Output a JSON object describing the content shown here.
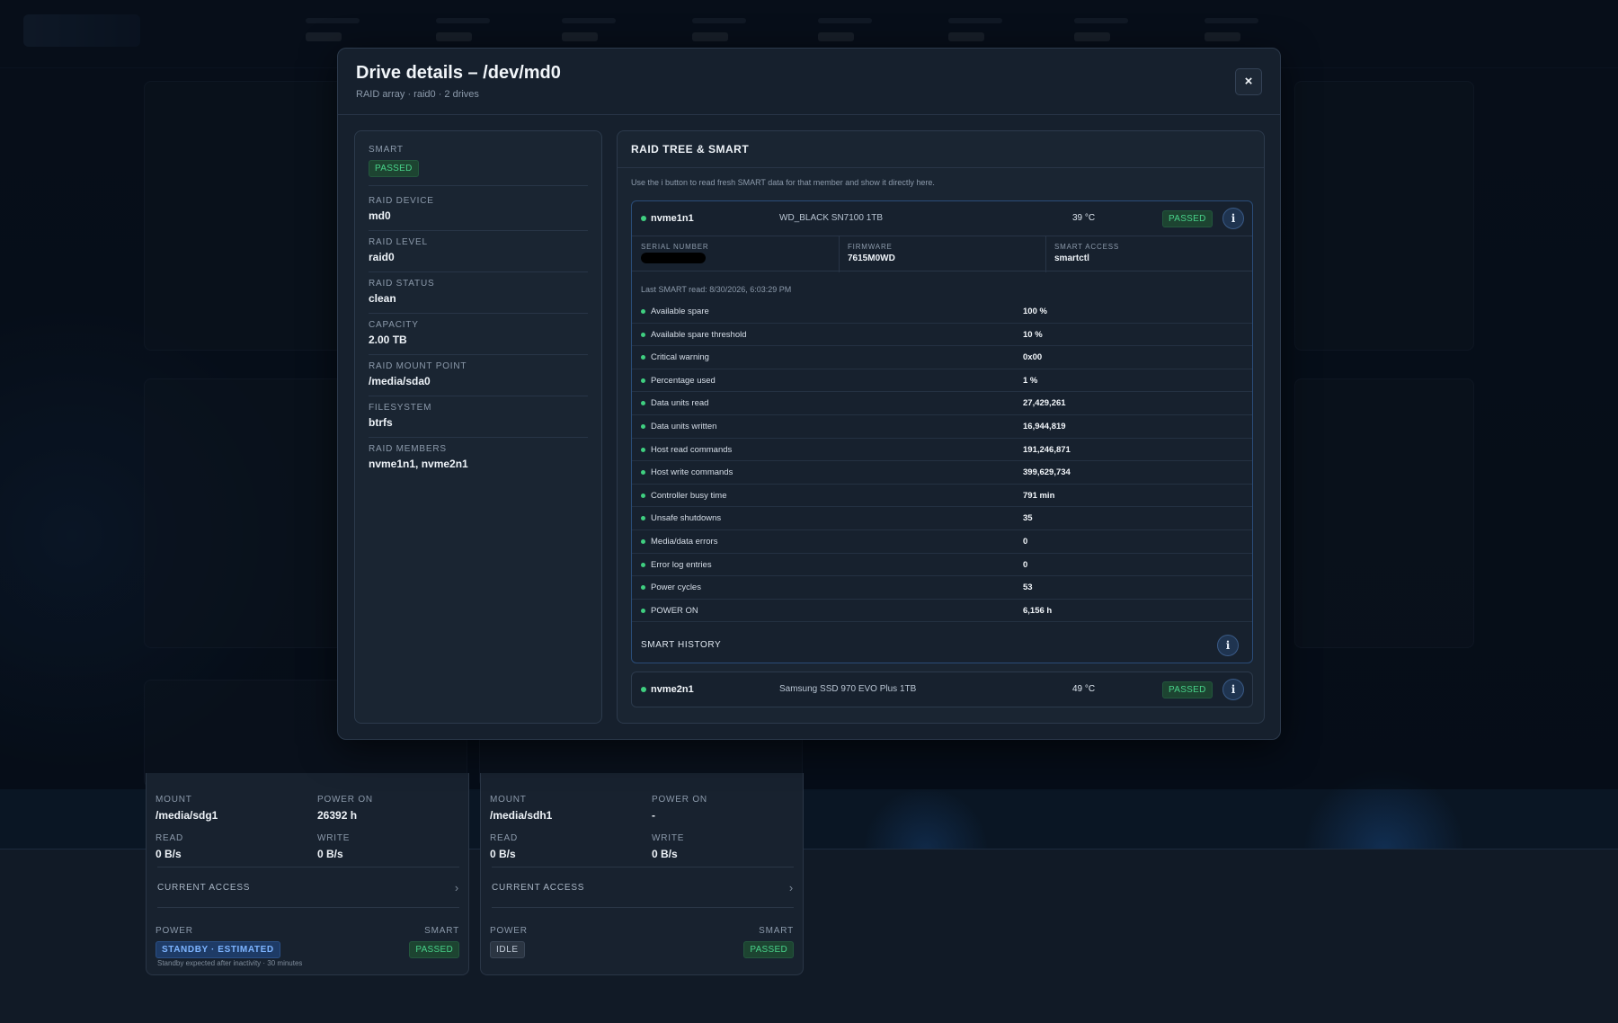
{
  "background_cards": [
    {
      "mount_label": "MOUNT",
      "mount": "/media/sdg1",
      "power_on_label": "POWER ON",
      "power_on": "26392 h",
      "read_label": "READ",
      "read": "0 B/s",
      "write_label": "WRITE",
      "write": "0 B/s",
      "access_label": "CURRENT ACCESS",
      "power_label": "POWER",
      "power_state": "STANDBY · ESTIMATED",
      "smart_label": "SMART",
      "smart": "PASSED",
      "note": "Standby expected after inactivity · 30 minutes"
    },
    {
      "mount_label": "MOUNT",
      "mount": "/media/sdh1",
      "power_on_label": "POWER ON",
      "power_on": "-",
      "read_label": "READ",
      "read": "0 B/s",
      "write_label": "WRITE",
      "write": "0 B/s",
      "access_label": "CURRENT ACCESS",
      "power_label": "POWER",
      "power_state": "IDLE",
      "smart_label": "SMART",
      "smart": "PASSED"
    }
  ],
  "modal": {
    "title": "Drive details – /dev/md0",
    "subtitle": "RAID array · raid0 · 2 drives",
    "close_label": "×",
    "fields": [
      {
        "label": "SMART",
        "value": "PASSED",
        "badge": true
      },
      {
        "label": "RAID DEVICE",
        "value": "md0"
      },
      {
        "label": "RAID LEVEL",
        "value": "raid0"
      },
      {
        "label": "RAID STATUS",
        "value": "clean"
      },
      {
        "label": "CAPACITY",
        "value": "2.00 TB"
      },
      {
        "label": "RAID MOUNT POINT",
        "value": "/media/sda0"
      },
      {
        "label": "FILESYSTEM",
        "value": "btrfs"
      },
      {
        "label": "RAID MEMBERS",
        "value": "nvme1n1, nvme2n1"
      }
    ],
    "raid_panel": {
      "title": "RAID TREE & SMART",
      "hint": "Use the i button to read fresh SMART data for that member and show it directly here.",
      "info_label": "i",
      "members": [
        {
          "name": "nvme1n1",
          "model": "WD_BLACK SN7100 1TB",
          "temp": "39 °C",
          "status": "PASSED",
          "serial_label": "SERIAL NUMBER",
          "firmware_label": "FIRMWARE",
          "firmware": "7615M0WD",
          "access_label": "SMART ACCESS",
          "access": "smartctl",
          "last_read": "Last SMART read: 8/30/2026, 6:03:29 PM",
          "attributes": [
            {
              "name": "Available spare",
              "value": "100 %"
            },
            {
              "name": "Available spare threshold",
              "value": "10 %"
            },
            {
              "name": "Critical warning",
              "value": "0x00"
            },
            {
              "name": "Percentage used",
              "value": "1 %"
            },
            {
              "name": "Data units read",
              "value": "27,429,261"
            },
            {
              "name": "Data units written",
              "value": "16,944,819"
            },
            {
              "name": "Host read commands",
              "value": "191,246,871"
            },
            {
              "name": "Host write commands",
              "value": "399,629,734"
            },
            {
              "name": "Controller busy time",
              "value": "791 min"
            },
            {
              "name": "Unsafe shutdowns",
              "value": "35"
            },
            {
              "name": "Media/data errors",
              "value": "0"
            },
            {
              "name": "Error log entries",
              "value": "0"
            },
            {
              "name": "Power cycles",
              "value": "53"
            },
            {
              "name": "POWER ON",
              "value": "6,156 h"
            }
          ],
          "history_label": "SMART HISTORY"
        },
        {
          "name": "nvme2n1",
          "model": "Samsung SSD 970 EVO Plus 1TB",
          "temp": "49 °C",
          "status": "PASSED"
        }
      ]
    }
  },
  "colors": {
    "accent": "#3a5a86",
    "passed": "#48d28a",
    "standby": "#7db4ff"
  }
}
